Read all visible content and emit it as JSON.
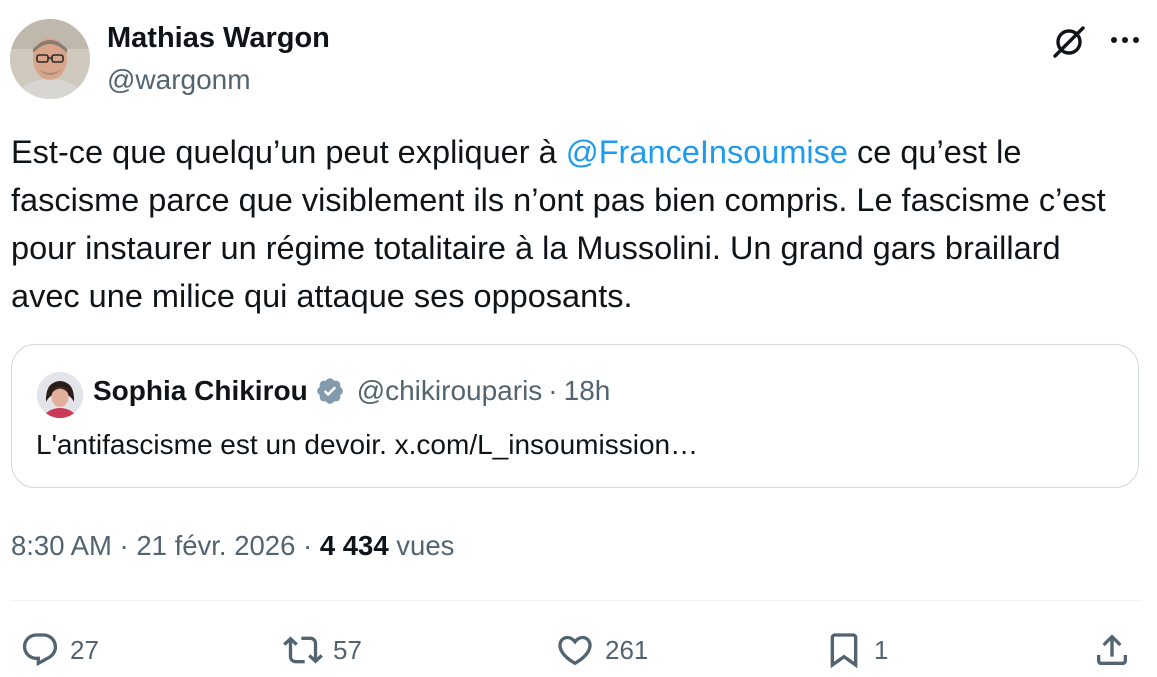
{
  "author": {
    "name": "Mathias Wargon",
    "handle": "@wargonm"
  },
  "header_icons": [
    "grok-icon",
    "more-icon"
  ],
  "tweet": {
    "text_before": "Est-ce que quelqu’un peut expliquer à ",
    "mention": "@FranceInsoumise",
    "text_after": " ce qu’est le fascisme parce que visiblement ils n’ont pas bien compris. Le fascisme c’est pour instaurer un régime totalitaire à la Mussolini. Un grand gars braillard avec une milice qui attaque ses opposants."
  },
  "quote": {
    "name": "Sophia Chikirou",
    "verified": true,
    "handle": "@chikirouparis",
    "separator": "·",
    "time": "18h",
    "text": "L'antifascisme est un devoir. x.com/L_insoumission…"
  },
  "meta": {
    "time": "8:30 AM",
    "sep1": "·",
    "date": "21 févr. 2026",
    "sep2": "·",
    "views_count": "4 434",
    "views_label": "vues"
  },
  "actions": {
    "replies": "27",
    "reposts": "57",
    "likes": "261",
    "bookmarks": "1"
  },
  "colors": {
    "text": "#0f1419",
    "secondary": "#536471",
    "link": "#1d9bf0",
    "border": "#cfd9de",
    "verified_badge": "#829aab"
  }
}
